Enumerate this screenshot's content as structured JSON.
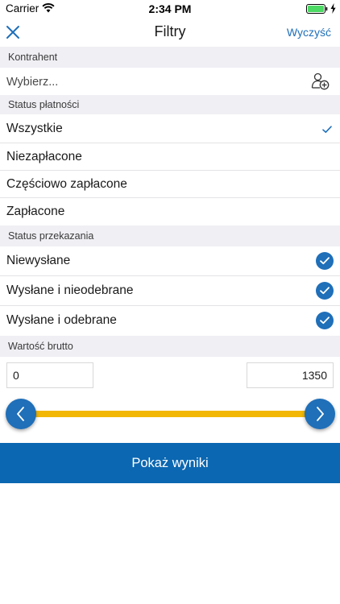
{
  "status_bar": {
    "carrier": "Carrier",
    "time": "2:34 PM"
  },
  "nav": {
    "title": "Filtry",
    "clear_label": "Wyczyść",
    "close_icon": "close-icon"
  },
  "contractor": {
    "header": "Kontrahent",
    "placeholder": "Wybierz...",
    "icon": "add-user-icon"
  },
  "payment_status": {
    "header": "Status płatności",
    "options": [
      {
        "label": "Wszystkie",
        "selected": true
      },
      {
        "label": "Niezapłacone",
        "selected": false
      },
      {
        "label": "Częściowo zapłacone",
        "selected": false
      },
      {
        "label": "Zapłacone",
        "selected": false
      }
    ]
  },
  "transfer_status": {
    "header": "Status przekazania",
    "options": [
      {
        "label": "Niewysłane",
        "checked": true
      },
      {
        "label": "Wysłane i nieodebrane",
        "checked": true
      },
      {
        "label": "Wysłane i odebrane",
        "checked": true
      }
    ]
  },
  "gross_value": {
    "header": "Wartość brutto",
    "min": "0",
    "max": "1350"
  },
  "show_results_label": "Pokaż wyniki",
  "colors": {
    "accent": "#1f6fb9",
    "button": "#0b67b1",
    "slider_track": "#f2b705",
    "section_bg": "#efeff4"
  }
}
